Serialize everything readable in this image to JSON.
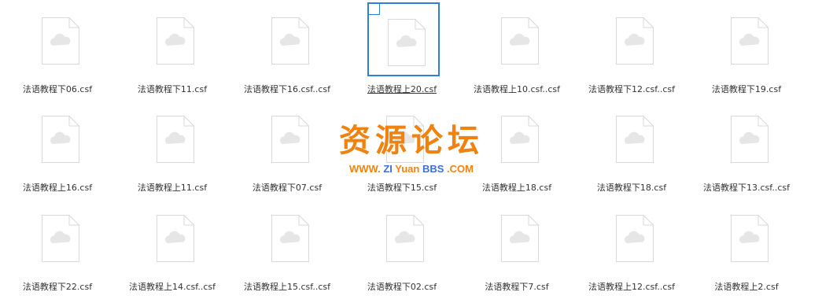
{
  "icons": {
    "file": "blank-file-cloud-icon",
    "select": "checkbox-icon"
  },
  "colors": {
    "selection": "#2f7fdb",
    "watermark_orange": "#f0820f",
    "watermark_blue": "#3d6fd6",
    "icon_stroke": "#d9d9d9",
    "icon_cloud": "#e6e6e6"
  },
  "files": [
    {
      "name": "法语教程下06.csf",
      "selected": false
    },
    {
      "name": "法语教程下11.csf",
      "selected": false
    },
    {
      "name": "法语教程下16.csf..csf",
      "selected": false
    },
    {
      "name": "法语教程上20.csf",
      "selected": true
    },
    {
      "name": "法语教程上10.csf..csf",
      "selected": false
    },
    {
      "name": "法语教程下12.csf..csf",
      "selected": false
    },
    {
      "name": "法语教程下19.csf",
      "selected": false
    },
    {
      "name": "法语教程上16.csf",
      "selected": false
    },
    {
      "name": "法语教程上11.csf",
      "selected": false
    },
    {
      "name": "法语教程下07.csf",
      "selected": false
    },
    {
      "name": "法语教程下15.csf",
      "selected": false
    },
    {
      "name": "法语教程上18.csf",
      "selected": false
    },
    {
      "name": "法语教程下18.csf",
      "selected": false
    },
    {
      "name": "法语教程下13.csf..csf",
      "selected": false
    },
    {
      "name": "法语教程下22.csf",
      "selected": false
    },
    {
      "name": "法语教程上14.csf..csf",
      "selected": false
    },
    {
      "name": "法语教程上15.csf..csf",
      "selected": false
    },
    {
      "name": "法语教程下02.csf",
      "selected": false
    },
    {
      "name": "法语教程下7.csf",
      "selected": false
    },
    {
      "name": "法语教程上12.csf..csf",
      "selected": false
    },
    {
      "name": "法语教程上2.csf",
      "selected": false
    }
  ],
  "watermark": {
    "title": "资源论坛",
    "url_segments": [
      {
        "text": "WWW.",
        "color": "#f0820f"
      },
      {
        "text": " ZI",
        "color": "#3d6fd6"
      },
      {
        "text": " Yuan",
        "color": "#f0820f"
      },
      {
        "text": " BBS",
        "color": "#3d6fd6"
      },
      {
        "text": " .COM",
        "color": "#f0820f"
      }
    ]
  }
}
